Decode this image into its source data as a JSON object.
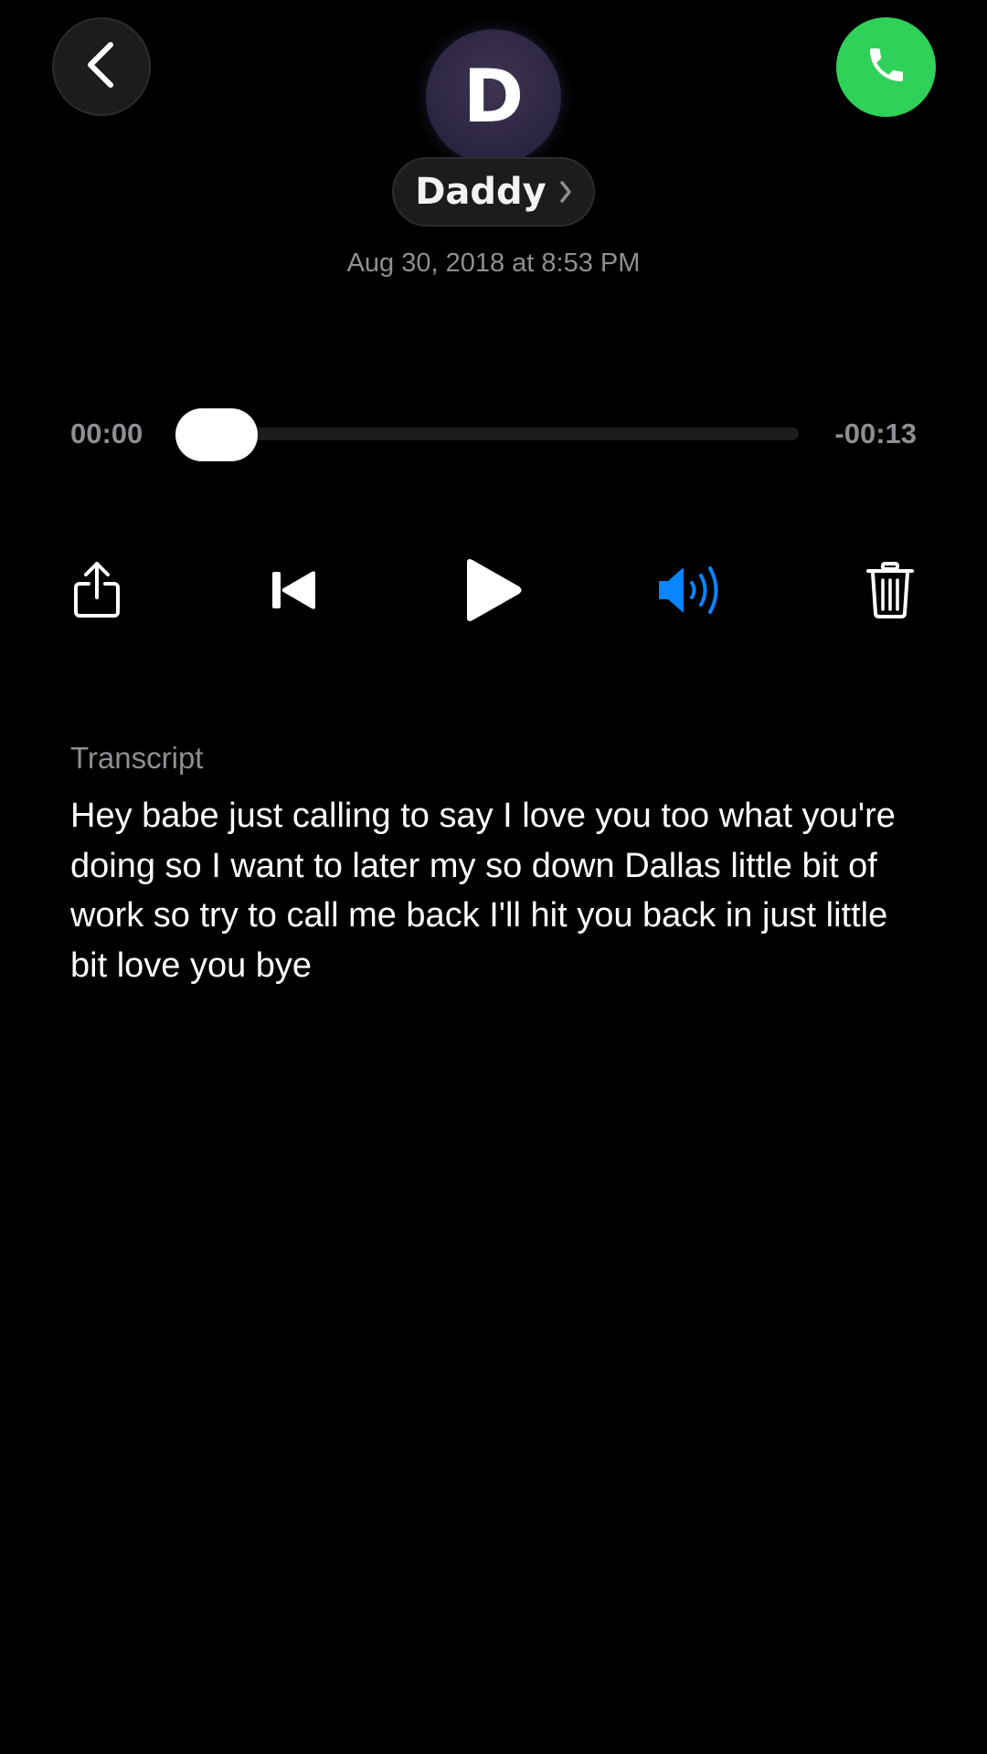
{
  "header": {
    "avatar_initial": "D",
    "contact_name": "Daddy",
    "date": "Aug 30, 2018 at 8:53 PM",
    "back_icon": "chevron-left-icon",
    "call_icon": "phone-icon",
    "call_color": "#30d158"
  },
  "player": {
    "elapsed": "00:00",
    "remaining": "-00:13",
    "progress": 0,
    "controls": [
      {
        "icon": "share-icon"
      },
      {
        "icon": "skip-back-icon"
      },
      {
        "icon": "play-icon"
      },
      {
        "icon": "speaker-icon",
        "color": "#0a84ff"
      },
      {
        "icon": "trash-icon"
      }
    ]
  },
  "transcript": {
    "label": "Transcript",
    "text": "Hey babe just calling to say I love you too what you're doing so I want to later my so down Dallas little bit of work so try to call me back I'll hit you back in just little bit love you bye"
  }
}
